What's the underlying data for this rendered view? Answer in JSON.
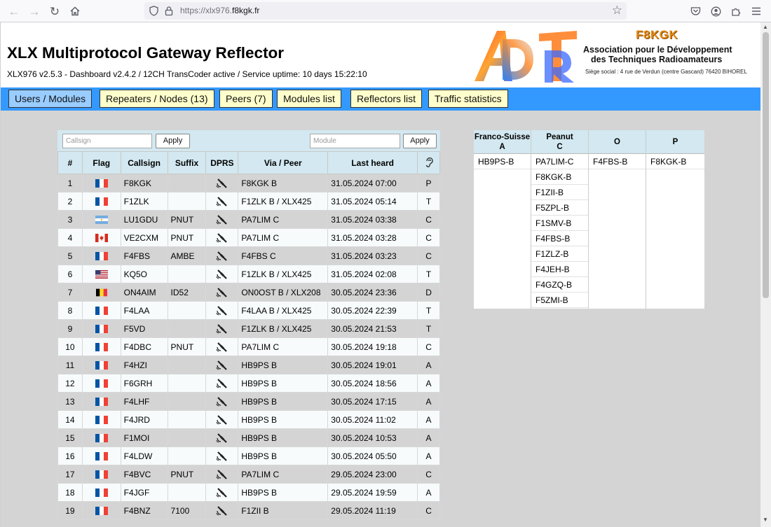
{
  "browser": {
    "url_prefix": "https://xlx976.",
    "url_domain": "f8kgk.fr"
  },
  "header": {
    "title": "XLX Multiprotocol Gateway Reflector",
    "subtitle": "XLX976 v2.5.3 - Dashboard v2.4.2 / 12CH TransCoder active  /  Service uptime: 10 days 15:22:10",
    "logo_callsign": "F8KGK",
    "logo_line1": "Association pour le Développement",
    "logo_line2": "des Techniques Radioamateurs",
    "logo_address": "Siège social : 4 rue de Verdun (centre Gascard) 76420 BIHOREL"
  },
  "menu": [
    "Users / Modules",
    "Repeaters / Nodes (13)",
    "Peers (7)",
    "Modules list",
    "Reflectors list",
    "Traffic statistics"
  ],
  "filters": {
    "callsign_placeholder": "Callsign",
    "module_placeholder": "Module",
    "apply_label": "Apply"
  },
  "users_table": {
    "columns": [
      "#",
      "Flag",
      "Callsign",
      "Suffix",
      "DPRS",
      "Via / Peer",
      "Last heard"
    ],
    "rows": [
      {
        "n": "1",
        "flag": "fr",
        "callsign": "F8KGK",
        "suffix": "",
        "via": "F8KGK B",
        "heard": "31.05.2024 07:00",
        "mod": "P"
      },
      {
        "n": "2",
        "flag": "fr",
        "callsign": "F1ZLK",
        "suffix": "",
        "via": "F1ZLK B / XLX425",
        "heard": "31.05.2024 05:14",
        "mod": "T"
      },
      {
        "n": "3",
        "flag": "ar",
        "callsign": "LU1GDU",
        "suffix": "PNUT",
        "via": "PA7LIM C",
        "heard": "31.05.2024 03:38",
        "mod": "C"
      },
      {
        "n": "4",
        "flag": "ca",
        "callsign": "VE2CXM",
        "suffix": "PNUT",
        "via": "PA7LIM C",
        "heard": "31.05.2024 03:28",
        "mod": "C"
      },
      {
        "n": "5",
        "flag": "fr",
        "callsign": "F4FBS",
        "suffix": "AMBE",
        "via": "F4FBS C",
        "heard": "31.05.2024 03:23",
        "mod": "C"
      },
      {
        "n": "6",
        "flag": "us",
        "callsign": "KQ5O",
        "suffix": "",
        "via": "F1ZLK B / XLX425",
        "heard": "31.05.2024 02:08",
        "mod": "T"
      },
      {
        "n": "7",
        "flag": "be",
        "callsign": "ON4AIM",
        "suffix": "ID52",
        "via": "ON0OST B / XLX208",
        "heard": "30.05.2024 23:36",
        "mod": "D"
      },
      {
        "n": "8",
        "flag": "fr",
        "callsign": "F4LAA",
        "suffix": "",
        "via": "F4LAA B / XLX425",
        "heard": "30.05.2024 22:39",
        "mod": "T"
      },
      {
        "n": "9",
        "flag": "fr",
        "callsign": "F5VD",
        "suffix": "",
        "via": "F1ZLK B / XLX425",
        "heard": "30.05.2024 21:53",
        "mod": "T"
      },
      {
        "n": "10",
        "flag": "fr",
        "callsign": "F4DBC",
        "suffix": "PNUT",
        "via": "PA7LIM C",
        "heard": "30.05.2024 19:18",
        "mod": "C"
      },
      {
        "n": "11",
        "flag": "fr",
        "callsign": "F4HZI",
        "suffix": "",
        "via": "HB9PS B",
        "heard": "30.05.2024 19:01",
        "mod": "A"
      },
      {
        "n": "12",
        "flag": "fr",
        "callsign": "F6GRH",
        "suffix": "",
        "via": "HB9PS B",
        "heard": "30.05.2024 18:56",
        "mod": "A"
      },
      {
        "n": "13",
        "flag": "fr",
        "callsign": "F4LHF",
        "suffix": "",
        "via": "HB9PS B",
        "heard": "30.05.2024 17:15",
        "mod": "A"
      },
      {
        "n": "14",
        "flag": "fr",
        "callsign": "F4JRD",
        "suffix": "",
        "via": "HB9PS B",
        "heard": "30.05.2024 11:02",
        "mod": "A"
      },
      {
        "n": "15",
        "flag": "fr",
        "callsign": "F1MOI",
        "suffix": "",
        "via": "HB9PS B",
        "heard": "30.05.2024 10:53",
        "mod": "A"
      },
      {
        "n": "16",
        "flag": "fr",
        "callsign": "F4LDW",
        "suffix": "",
        "via": "HB9PS B",
        "heard": "30.05.2024 05:50",
        "mod": "A"
      },
      {
        "n": "17",
        "flag": "fr",
        "callsign": "F4BVC",
        "suffix": "PNUT",
        "via": "PA7LIM C",
        "heard": "29.05.2024 23:00",
        "mod": "C"
      },
      {
        "n": "18",
        "flag": "fr",
        "callsign": "F4JGF",
        "suffix": "",
        "via": "HB9PS B",
        "heard": "29.05.2024 19:59",
        "mod": "A"
      },
      {
        "n": "19",
        "flag": "fr",
        "callsign": "F4BNZ",
        "suffix": "7100",
        "via": "F1ZII B",
        "heard": "29.05.2024 11:19",
        "mod": "C"
      }
    ]
  },
  "modules": [
    {
      "name": "Franco-Suisse",
      "letter": "A",
      "items": [
        "HB9PS-B"
      ]
    },
    {
      "name": "Peanut",
      "letter": "C",
      "items": [
        "PA7LIM-C",
        "F8KGK-B",
        "F1ZII-B",
        "F5ZPL-B",
        "F1SMV-B",
        "F4FBS-B",
        "F1ZLZ-B",
        "F4JEH-B",
        "F4GZQ-B",
        "F5ZMI-B"
      ]
    },
    {
      "name": "",
      "letter": "O",
      "items": [
        "F4FBS-B"
      ]
    },
    {
      "name": "",
      "letter": "P",
      "items": [
        "F8KGK-B"
      ]
    }
  ],
  "colors": {
    "menu_bar": "#3399ff",
    "menu_button": "#ffffcc",
    "menu_button_active": "#99ccff",
    "table_header": "#d3e8f0",
    "page_background": "#d4d4d4"
  }
}
